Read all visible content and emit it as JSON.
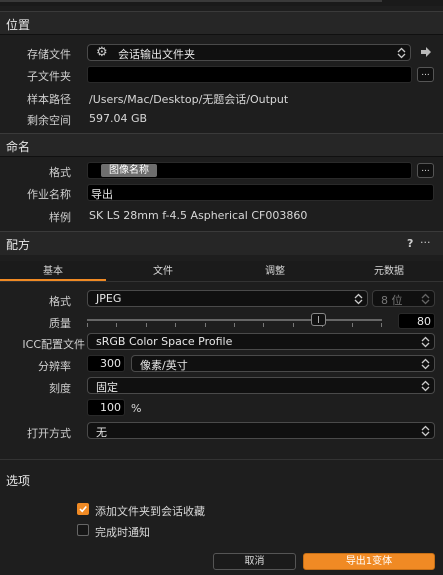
{
  "location": {
    "title": "位置",
    "storage_label": "存储文件",
    "storage_value": "会话输出文件夹",
    "subfolder_label": "子文件夹",
    "sample_path_label": "样本路径",
    "sample_path_value": "/Users/Mac/Desktop/无题会话/Output",
    "free_space_label": "剩余空间",
    "free_space_value": "597.04 GB",
    "more_button": "..."
  },
  "naming": {
    "title": "命名",
    "format_label": "格式",
    "format_token": "图像名称",
    "job_name_label": "作业名称",
    "job_name_value": "导出",
    "example_label": "样例",
    "example_value": "SK LS 28mm f-4.5 Aspherical CF003860",
    "more_button": "..."
  },
  "recipe": {
    "title": "配方",
    "help": "?",
    "more": "···",
    "tabs": [
      "基本",
      "文件",
      "调整",
      "元数据"
    ],
    "format_label": "格式",
    "format_value": "JPEG",
    "bit_value": "8 位",
    "quality_label": "质量",
    "quality_value": "80",
    "quality_fraction": 0.8,
    "icc_label": "ICC配置文件",
    "icc_value": "sRGB Color Space Profile",
    "resolution_label": "分辨率",
    "resolution_value": "300",
    "resolution_unit": "像素/英寸",
    "scale_label": "刻度",
    "scale_value": "固定",
    "scale_percent": "100",
    "percent_sign": "%",
    "open_with_label": "打开方式",
    "open_with_value": "无"
  },
  "options": {
    "title": "选项",
    "add_folder_label": "添加文件夹到会话收藏",
    "add_folder_checked": true,
    "notify_label": "完成时通知",
    "notify_checked": false
  },
  "footer": {
    "cancel": "取消",
    "export": "导出1变体"
  },
  "colors": {
    "accent": "#f08a24",
    "panel_bg": "#1e1e1e",
    "field_bg": "#000000"
  }
}
